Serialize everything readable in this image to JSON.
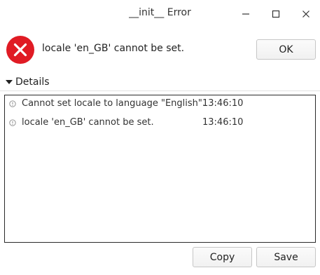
{
  "window": {
    "title": "__init__ Error"
  },
  "header": {
    "icon": "error-icon",
    "message": "locale 'en_GB' cannot be set.",
    "ok_label": "OK"
  },
  "details": {
    "toggle_label": "Details",
    "expanded": true,
    "entries": [
      {
        "icon": "info-icon",
        "text": "Cannot set locale to language \"English\".",
        "time": "13:46:10"
      },
      {
        "icon": "info-icon",
        "text": "locale 'en_GB' cannot be set.",
        "time": "13:46:10"
      }
    ]
  },
  "footer": {
    "copy_label": "Copy",
    "save_label": "Save"
  },
  "colors": {
    "error_red": "#e01b24",
    "border": "#2a2a2a"
  }
}
